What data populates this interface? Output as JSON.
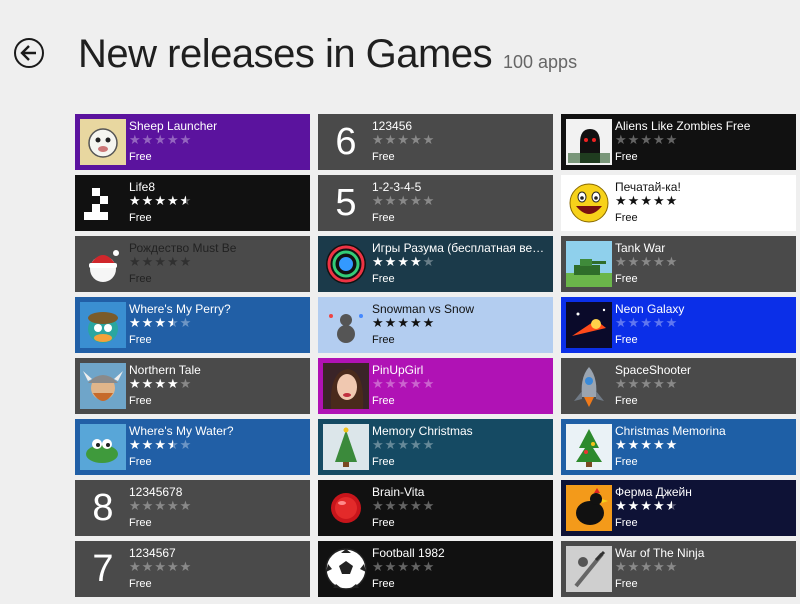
{
  "header": {
    "title": "New releases in Games",
    "count": "100 apps"
  },
  "apps": [
    {
      "name": "Sheep Launcher",
      "price": "Free",
      "rating": 0,
      "bg": "#5b139e",
      "thumb": "sheep"
    },
    {
      "name": "Life8",
      "price": "Free",
      "rating": 4.5,
      "bg": "#111111",
      "thumb": "life"
    },
    {
      "name": "Рождество Must Be",
      "price": "Free",
      "rating": 0,
      "bg": "#4a4a4a",
      "thumb": "santa",
      "dimtext": true
    },
    {
      "name": "Where's My Perry?",
      "price": "Free",
      "rating": 3.5,
      "bg": "#215fa6",
      "thumb": "perry"
    },
    {
      "name": "Northern Tale",
      "price": "Free",
      "rating": 4,
      "bg": "#4a4a4a",
      "thumb": "viking"
    },
    {
      "name": "Where's My Water?",
      "price": "Free",
      "rating": 3.5,
      "bg": "#215fa6",
      "thumb": "croc"
    },
    {
      "name": "12345678",
      "price": "Free",
      "rating": 0,
      "bg": "#4a4a4a",
      "thumb": "num",
      "num": "8"
    },
    {
      "name": "1234567",
      "price": "Free",
      "rating": 0,
      "bg": "#4a4a4a",
      "thumb": "num",
      "num": "7"
    },
    {
      "name": "123456",
      "price": "Free",
      "rating": 0,
      "bg": "#4a4a4a",
      "thumb": "num",
      "num": "6"
    },
    {
      "name": "1-2-3-4-5",
      "price": "Free",
      "rating": 0,
      "bg": "#4a4a4a",
      "thumb": "num",
      "num": "5"
    },
    {
      "name": "Игры Разума (бесплатная версия)",
      "price": "Free",
      "rating": 4,
      "bg": "#1b3a4a",
      "thumb": "mind"
    },
    {
      "name": "Snowman vs Snow",
      "price": "Free",
      "rating": 5,
      "bg": "#b3cdf0",
      "thumb": "snowman",
      "light": true
    },
    {
      "name": "PinUpGirl",
      "price": "Free",
      "rating": 0,
      "bg": "#b012b5",
      "thumb": "pinup"
    },
    {
      "name": "Memory Christmas",
      "price": "Free",
      "rating": 0,
      "bg": "#154a63",
      "thumb": "xtree"
    },
    {
      "name": "Brain-Vita",
      "price": "Free",
      "rating": 0,
      "bg": "#111111",
      "thumb": "brain"
    },
    {
      "name": "Football 1982",
      "price": "Free",
      "rating": 0,
      "bg": "#111111",
      "thumb": "ball"
    },
    {
      "name": "Aliens Like Zombies Free",
      "price": "Free",
      "rating": 0,
      "bg": "#111111",
      "thumb": "aliens"
    },
    {
      "name": "Печатай-ка!",
      "price": "Free",
      "rating": 5,
      "bg": "#ffffff",
      "thumb": "smile",
      "light": true
    },
    {
      "name": "Tank War",
      "price": "Free",
      "rating": 0,
      "bg": "#4a4a4a",
      "thumb": "tank"
    },
    {
      "name": "Neon Galaxy",
      "price": "Free",
      "rating": 0,
      "bg": "#0b2fe8",
      "thumb": "neon"
    },
    {
      "name": "SpaceShooter",
      "price": "Free",
      "rating": 0,
      "bg": "#4a4a4a",
      "thumb": "ship"
    },
    {
      "name": "Christmas Memorina",
      "price": "Free",
      "rating": 5,
      "bg": "#1e5fa6",
      "thumb": "xtree2"
    },
    {
      "name": "Ферма Джейн",
      "price": "Free",
      "rating": 4.5,
      "bg": "#0e1236",
      "thumb": "rooster"
    },
    {
      "name": "War of The Ninja",
      "price": "Free",
      "rating": 0,
      "bg": "#4a4a4a",
      "thumb": "ninja"
    }
  ]
}
